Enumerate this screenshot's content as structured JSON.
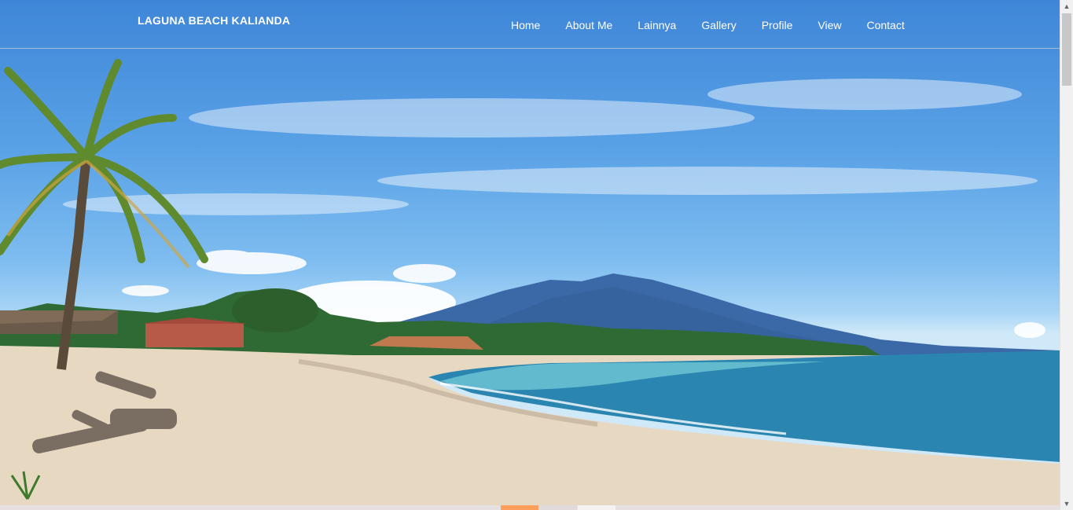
{
  "brand": "LAGUNA BEACH KALIANDA",
  "nav": {
    "items": [
      "Home",
      "About Me",
      "Lainnya",
      "Gallery",
      "Profile",
      "View",
      "Contact"
    ]
  },
  "slider": {
    "active_index": 0,
    "count": 3,
    "active_color": "#ff9f5b"
  },
  "scrollbar": {
    "up_icon": "▲",
    "down_icon": "▼"
  }
}
